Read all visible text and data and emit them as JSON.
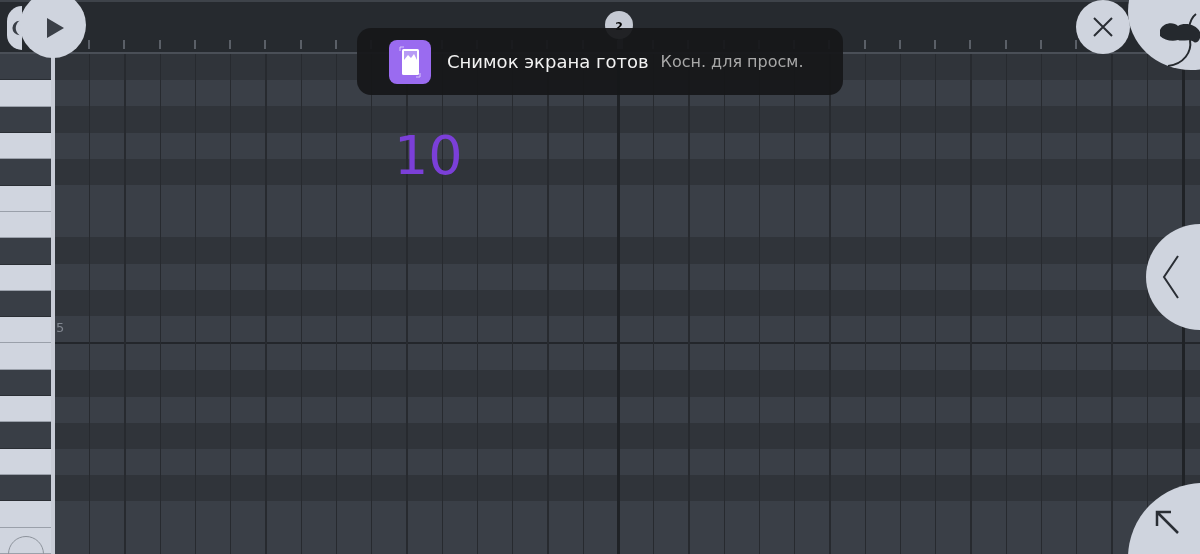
{
  "ruler": {
    "bar_marker": "2"
  },
  "toast": {
    "title": "Снимок экрана готов",
    "action": "Косн. для просм."
  },
  "overlay_number": "10",
  "rows": [
    {
      "kind": "black"
    },
    {
      "kind": "white"
    },
    {
      "kind": "black"
    },
    {
      "kind": "white"
    },
    {
      "kind": "black"
    },
    {
      "kind": "white"
    },
    {
      "kind": "white"
    },
    {
      "kind": "black"
    },
    {
      "kind": "white"
    },
    {
      "kind": "black"
    },
    {
      "kind": "white",
      "label": "5"
    },
    {
      "kind": "white"
    },
    {
      "kind": "black"
    },
    {
      "kind": "white"
    },
    {
      "kind": "black"
    },
    {
      "kind": "white"
    },
    {
      "kind": "black"
    },
    {
      "kind": "white"
    },
    {
      "kind": "white"
    }
  ]
}
